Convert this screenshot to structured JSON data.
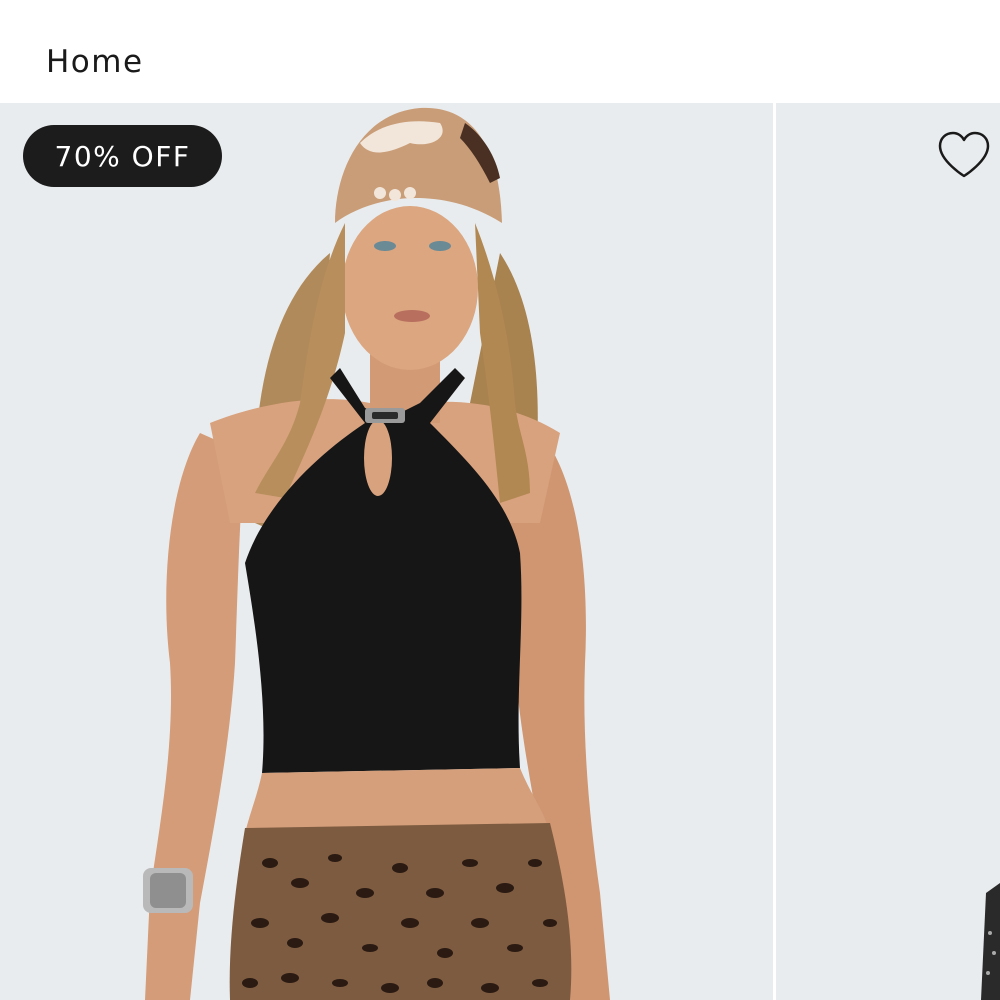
{
  "header": {
    "breadcrumb": "Home"
  },
  "product": {
    "discount_badge": "70% OFF",
    "wishlist_icon": "heart-outline-icon",
    "image_description_icon": "product-photo"
  },
  "colors": {
    "badge_background": "#1c1c1c",
    "badge_text": "#ffffff",
    "photo_background": "#e9ecee"
  }
}
